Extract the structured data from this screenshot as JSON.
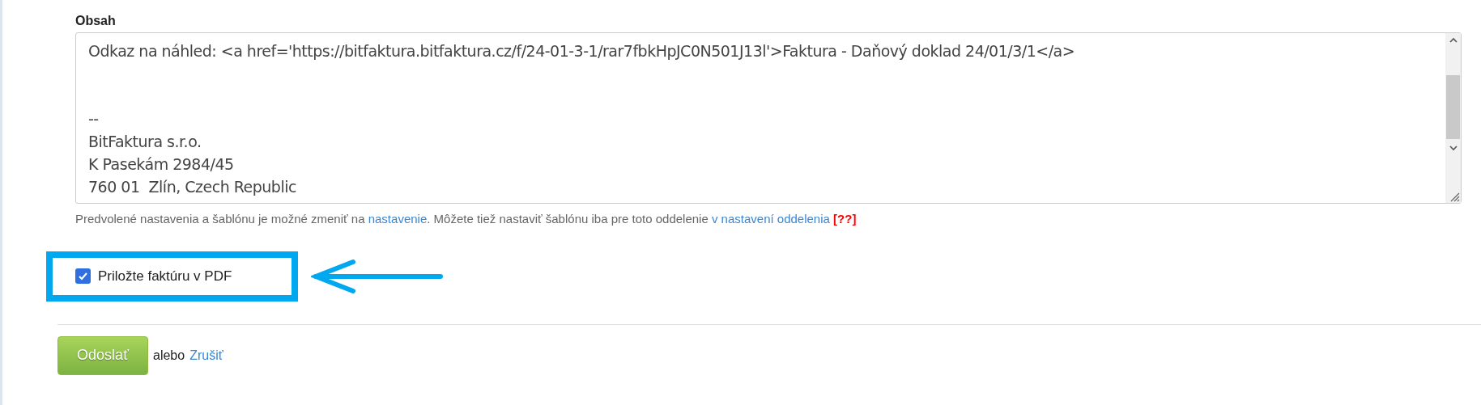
{
  "content_field": {
    "label": "Obsah",
    "first_line": "Odkaz na náhled: <a href='https://bitfaktura.bitfaktura.cz/f/24-01-3-1/rar7fbkHpJC0N501J13l'>Faktura - Daňový doklad 24/01/3/1</a>",
    "signature": [
      "--",
      "BitFaktura s.r.o.",
      "K Pasekám 2984/45",
      "760 01  Zlín, Czech Republic"
    ]
  },
  "hint": {
    "text_1": "Predvolené nastavenia a šablónu je možné zmeniť na ",
    "link_1": "nastavenie",
    "text_2": ". Môžete tiež nastaviť šablónu iba pre toto oddelenie ",
    "link_2": "v nastavení oddelenia",
    "help": "[??]"
  },
  "attach_pdf": {
    "label": "Priložte faktúru v PDF",
    "checked": true
  },
  "actions": {
    "submit": "Odoslať",
    "or": "alebo",
    "cancel": "Zrušiť"
  }
}
